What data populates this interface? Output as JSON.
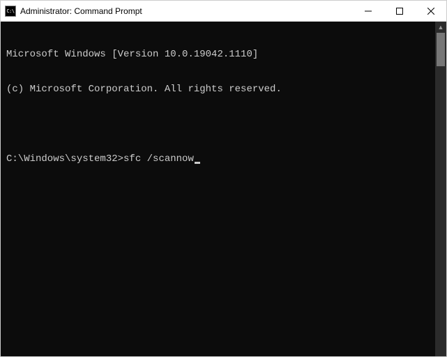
{
  "titlebar": {
    "icon_text": "C:\\",
    "title": "Administrator: Command Prompt"
  },
  "terminal": {
    "line1": "Microsoft Windows [Version 10.0.19042.1110]",
    "line2": "(c) Microsoft Corporation. All rights reserved.",
    "prompt": "C:\\Windows\\system32>",
    "command": "sfc /scannow"
  }
}
